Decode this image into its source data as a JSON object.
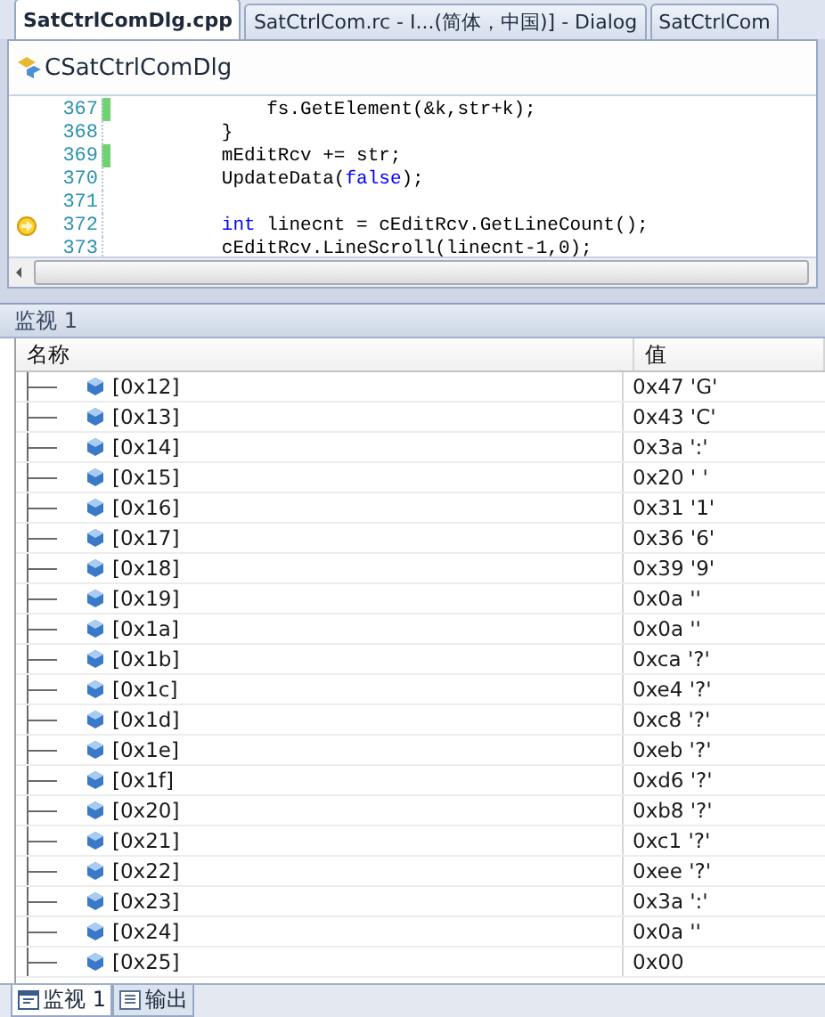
{
  "editor_tabs": [
    {
      "label": "SatCtrlComDlg.cpp",
      "selected": true
    },
    {
      "label": "SatCtrlCom.rc - I...(简体，中国)] - Dialog",
      "selected": false
    },
    {
      "label": "SatCtrlCom",
      "selected": false
    }
  ],
  "class_selector": {
    "value": "CSatCtrlComDlg"
  },
  "code": {
    "lines": [
      {
        "number": "367",
        "changed": true,
        "current": false,
        "segments": [
          {
            "text": "            fs.GetElement(&k,str+k);",
            "kind": "plain"
          }
        ]
      },
      {
        "number": "368",
        "changed": false,
        "current": false,
        "segments": [
          {
            "text": "        }",
            "kind": "plain"
          }
        ]
      },
      {
        "number": "369",
        "changed": true,
        "current": false,
        "segments": [
          {
            "text": "        mEditRcv += str;",
            "kind": "plain"
          }
        ]
      },
      {
        "number": "370",
        "changed": false,
        "current": false,
        "segments": [
          {
            "text": "        UpdateData(",
            "kind": "plain"
          },
          {
            "text": "false",
            "kind": "keyword"
          },
          {
            "text": ");",
            "kind": "plain"
          }
        ]
      },
      {
        "number": "371",
        "changed": false,
        "current": false
      },
      {
        "number": "372",
        "changed": false,
        "current": true,
        "segments": [
          {
            "text": "        int",
            "kind": "keyword"
          },
          {
            "text": " linecnt = cEditRcv.GetLineCount();",
            "kind": "plain"
          }
        ]
      },
      {
        "number": "373",
        "changed": false,
        "current": false,
        "segments": [
          {
            "text": "        cEditRcv.LineScroll(linecnt-1,0);",
            "kind": "plain"
          }
        ]
      }
    ]
  },
  "watch": {
    "title": "监视 1",
    "columns": [
      "名称",
      "值"
    ],
    "rows": [
      {
        "name": "[0x12]",
        "value": "0x47 'G'"
      },
      {
        "name": "[0x13]",
        "value": "0x43 'C'"
      },
      {
        "name": "[0x14]",
        "value": "0x3a ':'"
      },
      {
        "name": "[0x15]",
        "value": "0x20 ' '"
      },
      {
        "name": "[0x16]",
        "value": "0x31 '1'"
      },
      {
        "name": "[0x17]",
        "value": "0x36 '6'"
      },
      {
        "name": "[0x18]",
        "value": "0x39 '9'"
      },
      {
        "name": "[0x19]",
        "value": "0x0a ''"
      },
      {
        "name": "[0x1a]",
        "value": "0x0a ''"
      },
      {
        "name": "[0x1b]",
        "value": "0xca '?'"
      },
      {
        "name": "[0x1c]",
        "value": "0xe4 '?'"
      },
      {
        "name": "[0x1d]",
        "value": "0xc8 '?'"
      },
      {
        "name": "[0x1e]",
        "value": "0xeb '?'"
      },
      {
        "name": "[0x1f]",
        "value": "0xd6 '?'"
      },
      {
        "name": "[0x20]",
        "value": "0xb8 '?'"
      },
      {
        "name": "[0x21]",
        "value": "0xc1 '?'"
      },
      {
        "name": "[0x22]",
        "value": "0xee '?'"
      },
      {
        "name": "[0x23]",
        "value": "0x3a ':'"
      },
      {
        "name": "[0x24]",
        "value": "0x0a ''"
      },
      {
        "name": "[0x25]",
        "value": "0x00"
      }
    ]
  },
  "bottom_tabs": [
    {
      "label": "监视 1",
      "selected": true,
      "kind": "watch"
    },
    {
      "label": "输出",
      "selected": false,
      "kind": "output"
    }
  ]
}
